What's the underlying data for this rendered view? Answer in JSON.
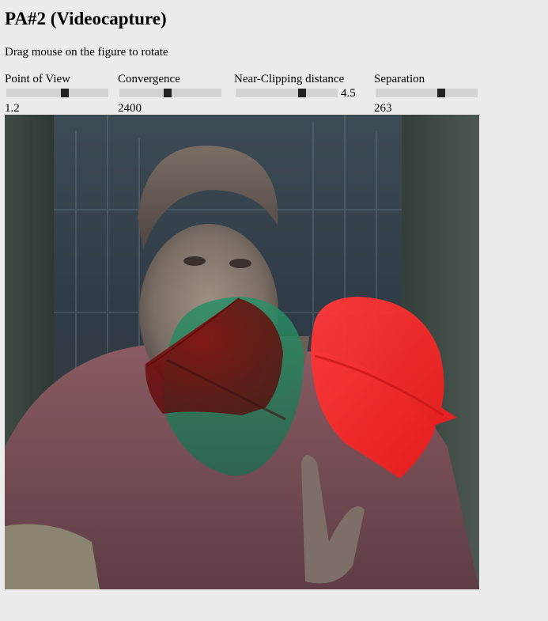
{
  "page": {
    "title": "PA#2 (Videocapture)",
    "instructions": "Drag mouse on the figure to rotate"
  },
  "controls": [
    {
      "label": "Point of View",
      "value": "1.2",
      "fraction": 0.57
    },
    {
      "label": "Convergence",
      "value": "2400",
      "fraction": 0.47
    },
    {
      "label": "Near-Clipping distance",
      "value": "4.5",
      "fraction": 0.65
    },
    {
      "label": "Separation",
      "value": "263",
      "fraction": 0.64
    }
  ],
  "colors": {
    "background": "#ececec",
    "slider_track": "#d3d3d3",
    "slider_thumb": "#222222",
    "anaglyph_red": "#ff1f1f",
    "anaglyph_cyan": "#2fa36e"
  }
}
